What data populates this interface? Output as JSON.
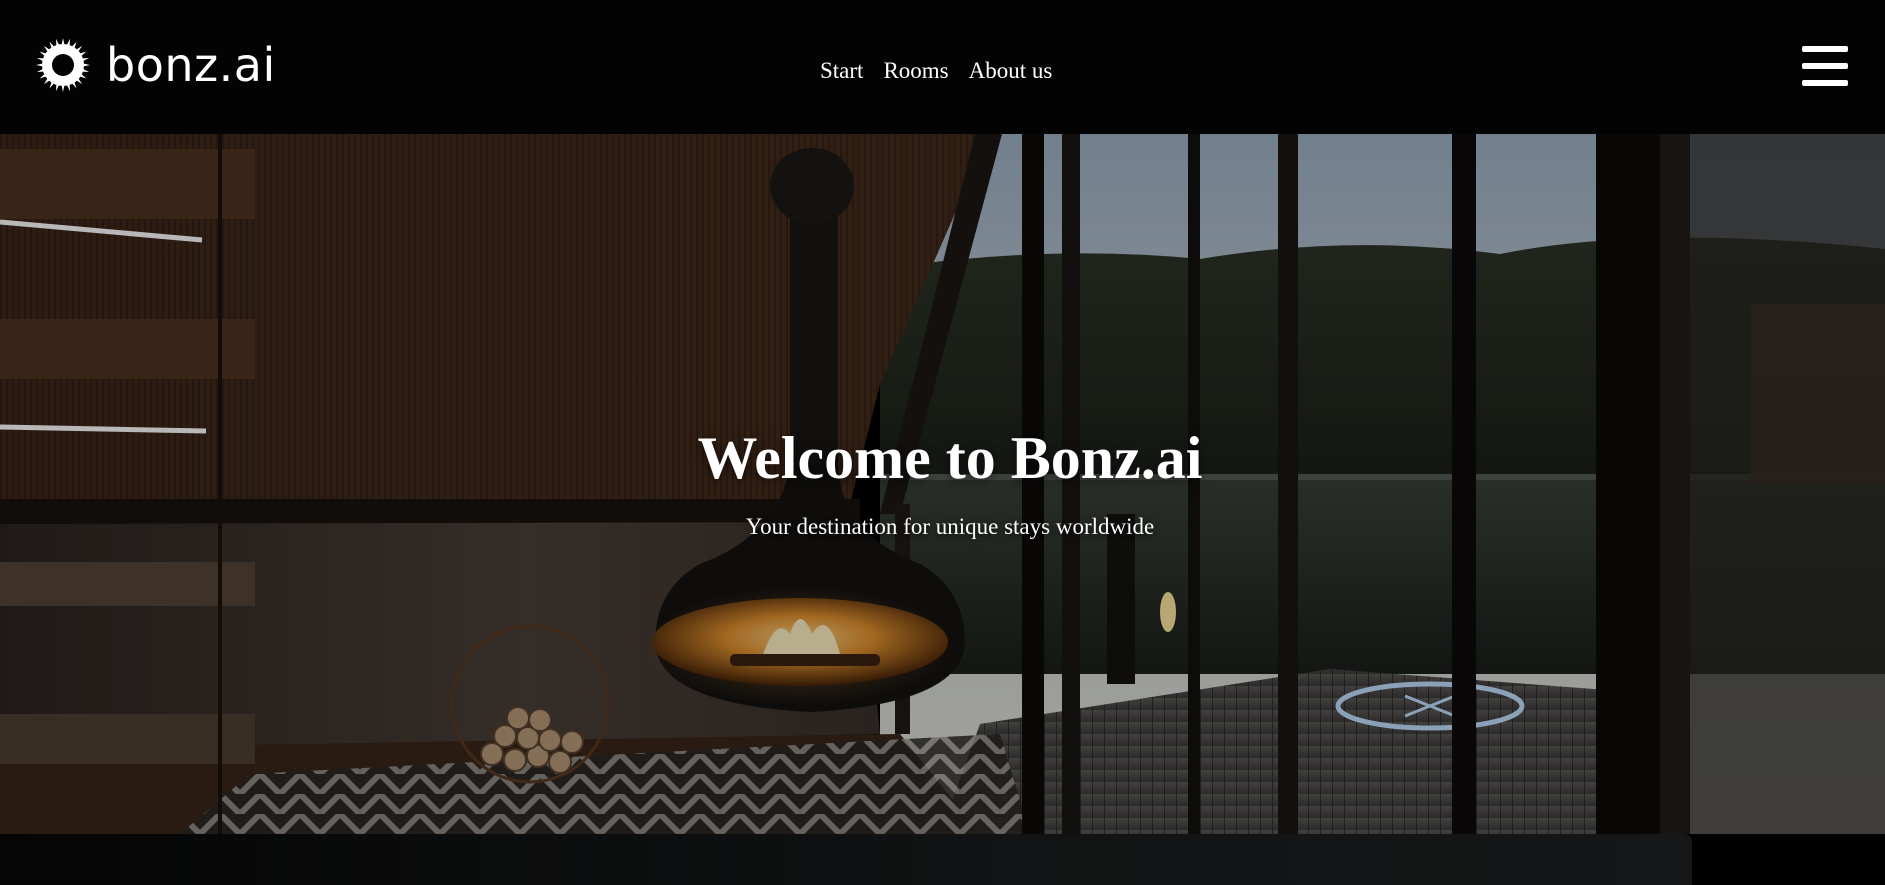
{
  "header": {
    "logo_text": "bonz.ai",
    "logo_icon": "sunburst-ring-icon",
    "nav": [
      {
        "label": "Start"
      },
      {
        "label": "Rooms"
      },
      {
        "label": "About us"
      }
    ],
    "menu_icon": "hamburger-menu-icon"
  },
  "hero": {
    "title": "Welcome to Bonz.ai",
    "subtitle": "Your destination for unique stays worldwide"
  },
  "colors": {
    "header_bg": "#030303",
    "text": "#ffffff",
    "fire": "#f0a040"
  }
}
